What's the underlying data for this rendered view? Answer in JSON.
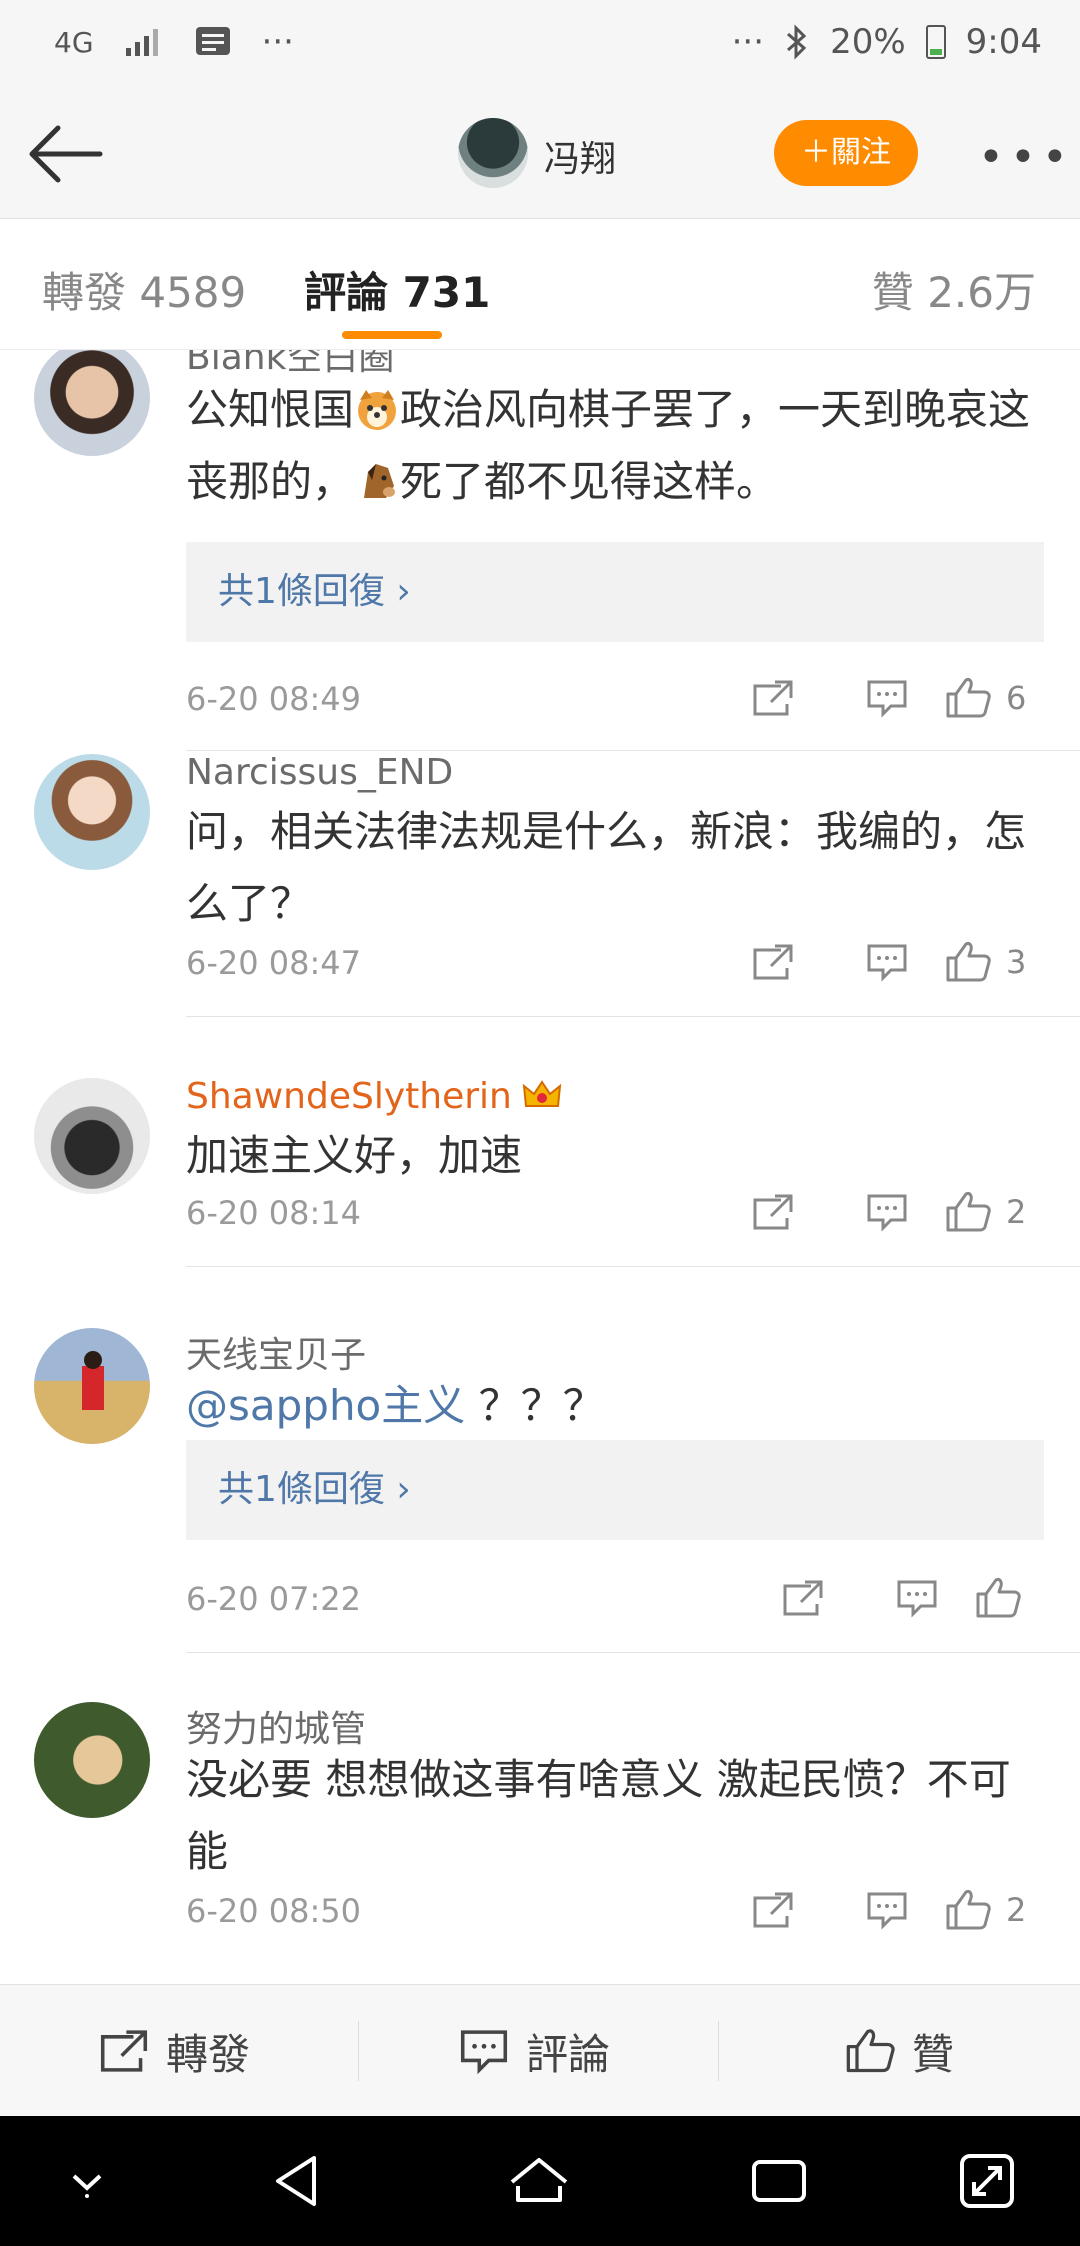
{
  "status_bar": {
    "network": "4G",
    "dots_left": "···",
    "dots_right": "···",
    "battery": "20%",
    "time": "9:04"
  },
  "header": {
    "user_name": "冯翔",
    "follow_label": "＋關注"
  },
  "tabs": [
    {
      "label": "轉發 4589"
    },
    {
      "label": "評論 731"
    },
    {
      "label": "贊 2.6万"
    }
  ],
  "comments": [
    {
      "name": "Blank空白圈",
      "text_parts": [
        "公知恨国",
        "政治风向棋子罢了，一天到晚哀这丧那的，",
        "死了都不见得这样。"
      ],
      "reply_label": "共1條回復 ›",
      "time": "6-20 08:49",
      "likes": "6"
    },
    {
      "name": "Narcissus_END",
      "text": "问，相关法律法规是什么，新浪：我编的，怎么了？",
      "time": "6-20 08:47",
      "likes": "3"
    },
    {
      "name": "ShawndeSlytherin",
      "text": "加速主义好，加速",
      "time": "6-20 08:14",
      "likes": "2"
    },
    {
      "name": "天线宝贝子",
      "mention": "@sappho主义",
      "text": " ？？？",
      "reply_label": "共1條回復 ›",
      "time": "6-20 07:22",
      "likes": ""
    },
    {
      "name": "努力的城管",
      "text": "没必要 想想做这事有啥意义 激起民愤？不可能",
      "time": "6-20 08:50",
      "likes": "2"
    }
  ],
  "bottom_bar": {
    "repost": "轉發",
    "comment": "評論",
    "like": "贊"
  },
  "colors": {
    "accent": "#ff8b00",
    "link": "#4f78a9",
    "vip_name": "#e3641b"
  }
}
